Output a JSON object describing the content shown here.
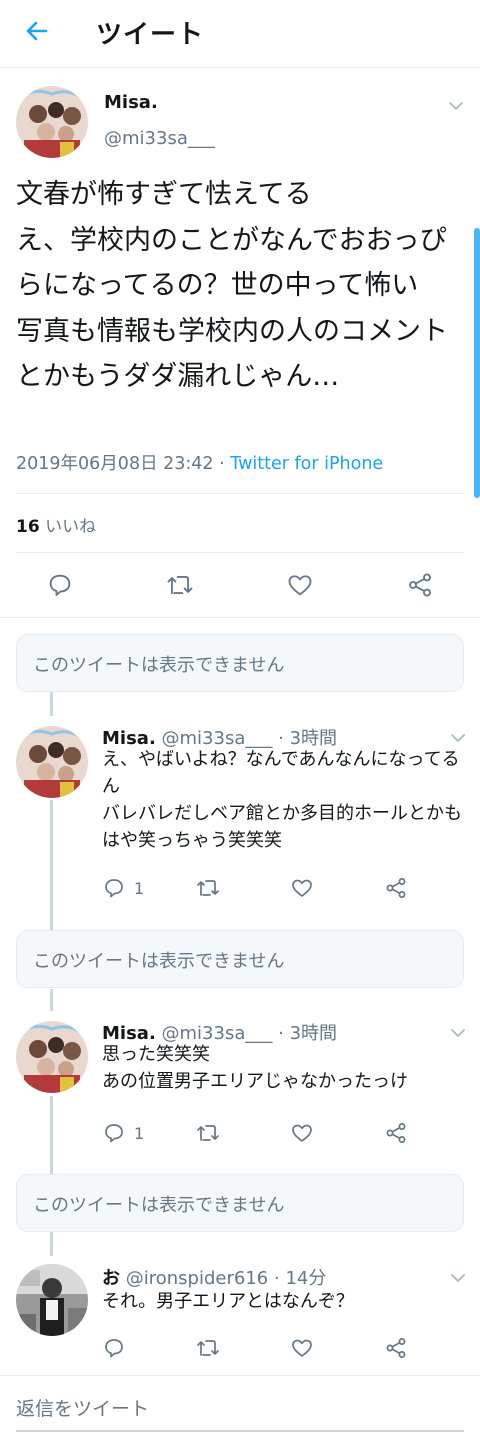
{
  "header": {
    "title": "ツイート"
  },
  "main_tweet": {
    "name": "Misa.",
    "handle": "@mi33sa___",
    "text": "文春が怖すぎて怯えてる\nえ、学校内のことがなんでおおっぴらになってるの？世の中って怖い\n写真も情報も学校内の人のコメントとかもうダダ漏れじゃん…",
    "date": "2019年06月08日 23:42",
    "separator": " · ",
    "source": "Twitter for iPhone",
    "likes_count": "16",
    "likes_label": "いいね"
  },
  "unavailable_label": "このツイートは表示できません",
  "replies": [
    {
      "name": "Misa.",
      "handle": "@mi33sa___",
      "time": "3時間",
      "text": "え、やばいよね？なんであんなんになってるん\nバレバレだしベア館とか多目的ホールとかもはや笑っちゃう笑笑笑",
      "reply_count": "1"
    },
    {
      "name": "Misa.",
      "handle": "@mi33sa___",
      "time": "3時間",
      "text": "思った笑笑笑\nあの位置男子エリアじゃなかったっけ",
      "reply_count": "1"
    },
    {
      "name": "お",
      "handle": "@ironspider616",
      "time": "14分",
      "text": "それ。男子エリアとはなんぞ？",
      "reply_count": ""
    }
  ],
  "compose": {
    "placeholder": "返信をツイート"
  },
  "colors": {
    "accent": "#1da1f2",
    "secondary_text": "#657786",
    "border": "#e6ecf0"
  },
  "icons": [
    "back-arrow-icon",
    "chevron-down-icon",
    "reply-icon",
    "retweet-icon",
    "like-icon",
    "share-icon"
  ]
}
